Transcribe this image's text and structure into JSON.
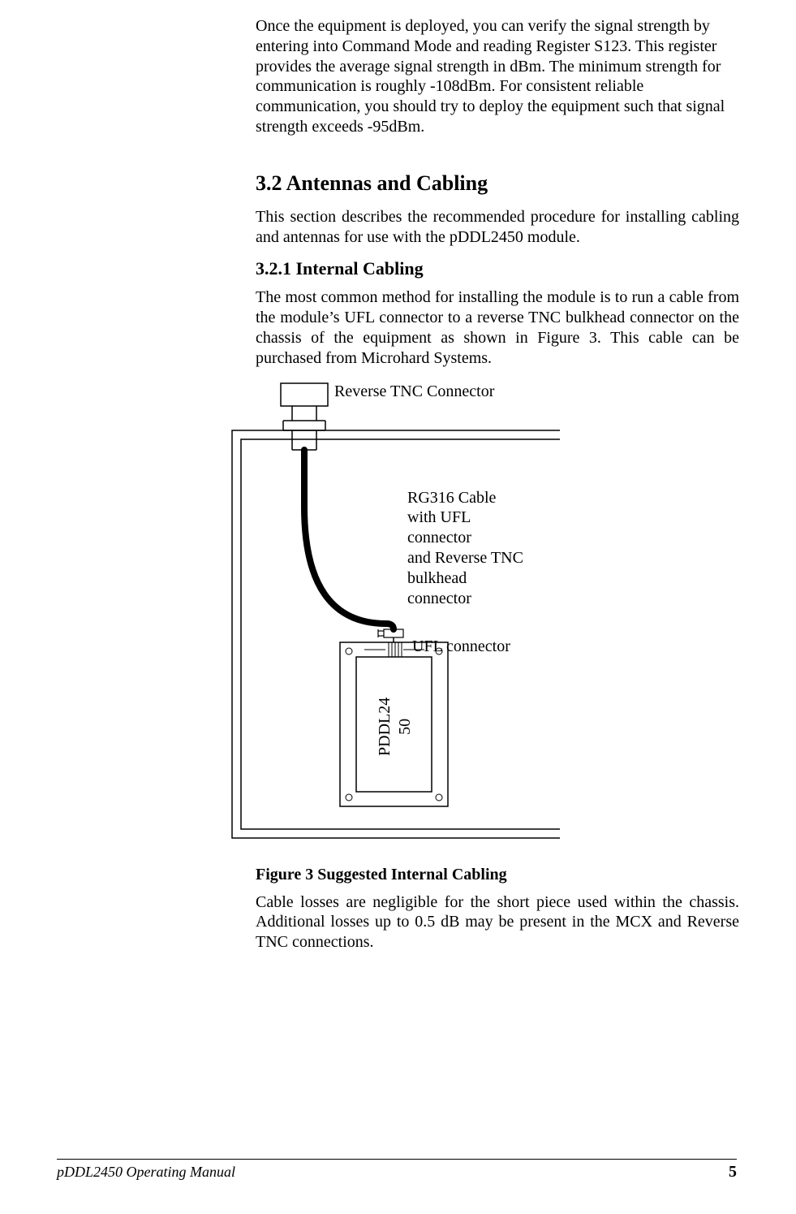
{
  "body": {
    "intro_para": "Once the equipment is deployed, you can verify the signal strength by entering into Command Mode and reading Register S123.  This register provides the average signal strength in dBm.  The minimum strength for communication is roughly -108dBm.  For consistent reliable communication, you should try to deploy the equipment such that signal strength exceeds -95dBm.",
    "h2": "3.2   Antennas and Cabling",
    "p32": "This section describes the recommended procedure for installing cabling and antennas for use with the pDDL2450 module.",
    "h3": "3.2.1    Internal Cabling",
    "p321": "The most common method for installing the module is to run a cable from the module’s UFL connector to a reverse TNC bulkhead connector on the chassis of the equipment as shown in Figure 3.  This cable can be purchased from Microhard Systems.",
    "figcap": "Figure 3 Suggested Internal Cabling",
    "closing": "Cable losses are negligible for the short piece used within the chassis.  Additional losses up to 0.5 dB may be present in the MCX and Reverse TNC connections."
  },
  "figure": {
    "tnc_label": "Reverse TNC Connector",
    "cable_label": "RG316 Cable\nwith UFL\nconnector\nand Reverse TNC\nbulkhead\nconnector",
    "ufl_label": "UFL connector",
    "module_label": "PDDL24\n50"
  },
  "footer": {
    "left": "pDDL2450 Operating Manual",
    "right": "5"
  }
}
